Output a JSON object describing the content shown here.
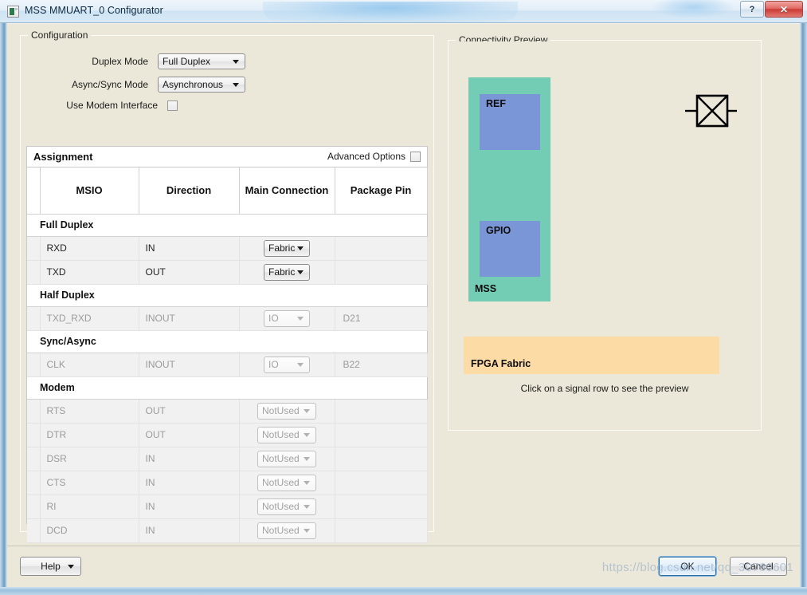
{
  "window": {
    "title": "MSS MMUART_0 Configurator",
    "icon": "window-icon",
    "help_button": "?",
    "close_button": "✕"
  },
  "configuration": {
    "group_title": "Configuration",
    "fields": [
      {
        "label": "Duplex Mode",
        "value": "Full Duplex",
        "type": "combo"
      },
      {
        "label": "Async/Sync Mode",
        "value": "Asynchronous",
        "type": "combo"
      },
      {
        "label": "Use Modem Interface",
        "value": "",
        "type": "checkbox",
        "checked": false
      }
    ]
  },
  "assignment": {
    "title": "Assignment",
    "advanced_options_label": "Advanced Options",
    "advanced_options_checked": false,
    "columns": [
      "",
      "MSIO",
      "Direction",
      "Main Connection",
      "Package Pin"
    ],
    "sections": [
      {
        "name": "Full Duplex",
        "rows": [
          {
            "msio": "RXD",
            "direction": "IN",
            "connection": "Fabric",
            "pin": "",
            "enabled": true
          },
          {
            "msio": "TXD",
            "direction": "OUT",
            "connection": "Fabric",
            "pin": "",
            "enabled": true
          }
        ]
      },
      {
        "name": "Half Duplex",
        "rows": [
          {
            "msio": "TXD_RXD",
            "direction": "INOUT",
            "connection": "IO",
            "pin": "D21",
            "enabled": false
          }
        ]
      },
      {
        "name": "Sync/Async",
        "rows": [
          {
            "msio": "CLK",
            "direction": "INOUT",
            "connection": "IO",
            "pin": "B22",
            "enabled": false
          }
        ]
      },
      {
        "name": "Modem",
        "rows": [
          {
            "msio": "RTS",
            "direction": "OUT",
            "connection": "NotUsed",
            "pin": "",
            "enabled": false
          },
          {
            "msio": "DTR",
            "direction": "OUT",
            "connection": "NotUsed",
            "pin": "",
            "enabled": false
          },
          {
            "msio": "DSR",
            "direction": "IN",
            "connection": "NotUsed",
            "pin": "",
            "enabled": false
          },
          {
            "msio": "CTS",
            "direction": "IN",
            "connection": "NotUsed",
            "pin": "",
            "enabled": false
          },
          {
            "msio": "RI",
            "direction": "IN",
            "connection": "NotUsed",
            "pin": "",
            "enabled": false
          },
          {
            "msio": "DCD",
            "direction": "IN",
            "connection": "NotUsed",
            "pin": "",
            "enabled": false
          }
        ]
      }
    ]
  },
  "preview": {
    "group_title": "Connectivity Preview",
    "mss_label": "MSS",
    "ref_label": "REF",
    "gpio_label": "GPIO",
    "fpga_label": "FPGA Fabric",
    "hint": "Click on a signal row to see the preview",
    "colors": {
      "mss": "#73ccb4",
      "sub_block": "#7b96d6",
      "fpga": "#fcdca4",
      "background": "#ece8d9"
    }
  },
  "footer": {
    "help": "Help",
    "ok": "OK",
    "cancel": "Cancel"
  },
  "watermark": "https://blog.csdn.net/qq_30760601"
}
